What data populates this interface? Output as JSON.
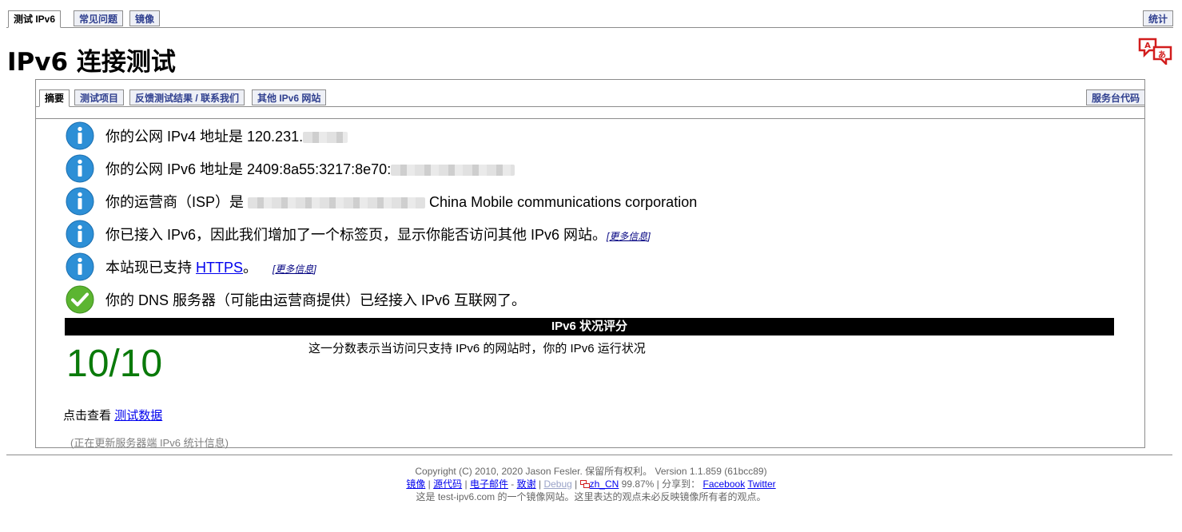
{
  "top_tabs": {
    "test": "测试 IPv6",
    "faq": "常见问题",
    "mirrors": "镜像",
    "stats": "统计"
  },
  "page_title": "IPv6 连接测试",
  "sub_tabs": {
    "summary": "摘要",
    "tests": "测试项目",
    "feedback": "反馈测试结果 / 联系我们",
    "other_sites": "其他 IPv6 网站",
    "helpdesk": "服务台代码"
  },
  "messages": {
    "ipv4": "你的公网 IPv4 地址是 120.231.",
    "ipv6": "你的公网 IPv6 地址是 2409:8a55:3217:8e70:",
    "isp_prefix": "你的运营商（ISP）是",
    "isp_name": "China Mobile communications corporation",
    "has_ipv6": "你已接入 IPv6，因此我们增加了一个标签页，显示你能否访问其他 IPv6 网站。",
    "more_info": "更多信息",
    "https_prefix": "本站现已支持",
    "https_link": "HTTPS",
    "https_suffix": "。",
    "dns": "你的 DNS 服务器（可能由运营商提供）已经接入 IPv6 互联网了。"
  },
  "score": {
    "header": "IPv6 状况评分",
    "value": "10/10",
    "description": "这一分数表示当访问只支持 IPv6 的网站时，你的 IPv6 运行状况"
  },
  "detail": {
    "prefix": "点击查看",
    "link": "测试数据"
  },
  "updating_note": "(正在更新服务器端 IPv6 统计信息)",
  "footer": {
    "copyright": "Copyright (C) 2010, 2020 Jason Fesler. 保留所有权利。 Version 1.1.859 (61bcc89)",
    "mirror": "镜像",
    "source": "源代码",
    "email": "电子邮件",
    "dash": " - ",
    "thanks": "致谢",
    "debug": "Debug",
    "locale": "zh_CN",
    "percent": "99.87%",
    "share": "分享到：",
    "facebook": "Facebook",
    "twitter": "Twitter",
    "mirror_note": "这是 test-ipv6.com 的一个镜像网站。这里表达的观点未必反映镜像所有者的观点。"
  },
  "colors": {
    "score": "#0a7a0a",
    "tab_text": "#2f3f8f",
    "info_icon": "#2d8fd6",
    "ok_icon": "#5cb531"
  }
}
